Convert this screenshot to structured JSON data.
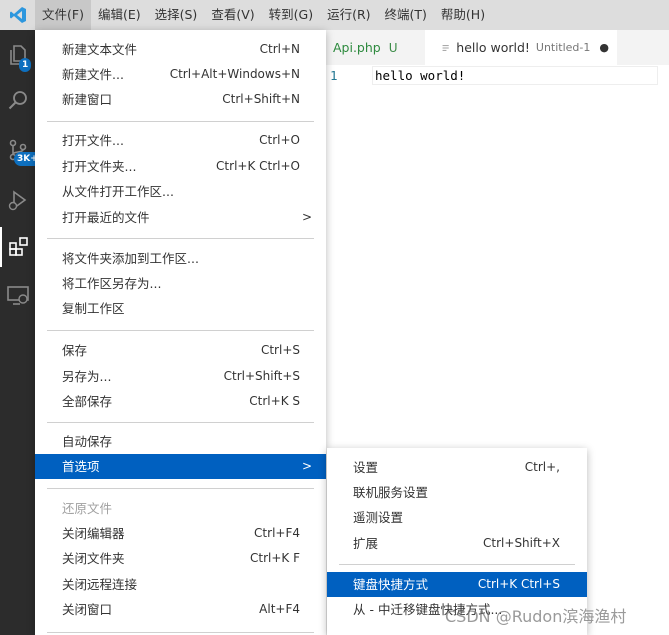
{
  "menubar": {
    "items": [
      "文件(F)",
      "编辑(E)",
      "选择(S)",
      "查看(V)",
      "转到(G)",
      "运行(R)",
      "终端(T)",
      "帮助(H)"
    ]
  },
  "activity": {
    "badge_explorer": "1",
    "badge_scm": "3K+"
  },
  "tabs": {
    "tab1_label": "Api.php",
    "tab1_status": "U",
    "tab2_label": "hello world!",
    "tab2_sub": "Untitled-1",
    "tab2_dot": "●"
  },
  "editor": {
    "line_number": "1",
    "code": "hello world!"
  },
  "file_menu": {
    "new_text_file": {
      "label": "新建文本文件",
      "shortcut": "Ctrl+N"
    },
    "new_file": {
      "label": "新建文件...",
      "shortcut": "Ctrl+Alt+Windows+N"
    },
    "new_window": {
      "label": "新建窗口",
      "shortcut": "Ctrl+Shift+N"
    },
    "open_file": {
      "label": "打开文件...",
      "shortcut": "Ctrl+O"
    },
    "open_folder": {
      "label": "打开文件夹...",
      "shortcut": "Ctrl+K Ctrl+O"
    },
    "open_workspace": {
      "label": "从文件打开工作区..."
    },
    "open_recent": {
      "label": "打开最近的文件",
      "chevron": ">"
    },
    "add_folder": {
      "label": "将文件夹添加到工作区..."
    },
    "save_workspace_as": {
      "label": "将工作区另存为..."
    },
    "duplicate_workspace": {
      "label": "复制工作区"
    },
    "save": {
      "label": "保存",
      "shortcut": "Ctrl+S"
    },
    "save_as": {
      "label": "另存为...",
      "shortcut": "Ctrl+Shift+S"
    },
    "save_all": {
      "label": "全部保存",
      "shortcut": "Ctrl+K S"
    },
    "auto_save": {
      "label": "自动保存"
    },
    "preferences": {
      "label": "首选项",
      "chevron": ">"
    },
    "revert_file": {
      "label": "还原文件"
    },
    "close_editor": {
      "label": "关闭编辑器",
      "shortcut": "Ctrl+F4"
    },
    "close_folder": {
      "label": "关闭文件夹",
      "shortcut": "Ctrl+K F"
    },
    "close_remote": {
      "label": "关闭远程连接"
    },
    "close_window": {
      "label": "关闭窗口",
      "shortcut": "Alt+F4"
    }
  },
  "prefs_menu": {
    "settings": {
      "label": "设置",
      "shortcut": "Ctrl+,"
    },
    "online_services": {
      "label": "联机服务设置"
    },
    "telemetry": {
      "label": "遥测设置"
    },
    "extensions": {
      "label": "扩展",
      "shortcut": "Ctrl+Shift+X"
    },
    "keyboard_shortcuts": {
      "label": "键盘快捷方式",
      "shortcut": "Ctrl+K Ctrl+S"
    },
    "migrate_keymaps": {
      "label": "从 - 中迁移键盘快捷方式..."
    }
  },
  "watermark": "CSDN @Rudon滨海渔村",
  "colors": {
    "highlight": "#0060c0",
    "activity_bar": "#2c2c2c",
    "menubar": "#dddddd",
    "badge": "#0e70c0",
    "vscode_logo": "#2d97de",
    "untracked_file": "#2d8a3e"
  }
}
